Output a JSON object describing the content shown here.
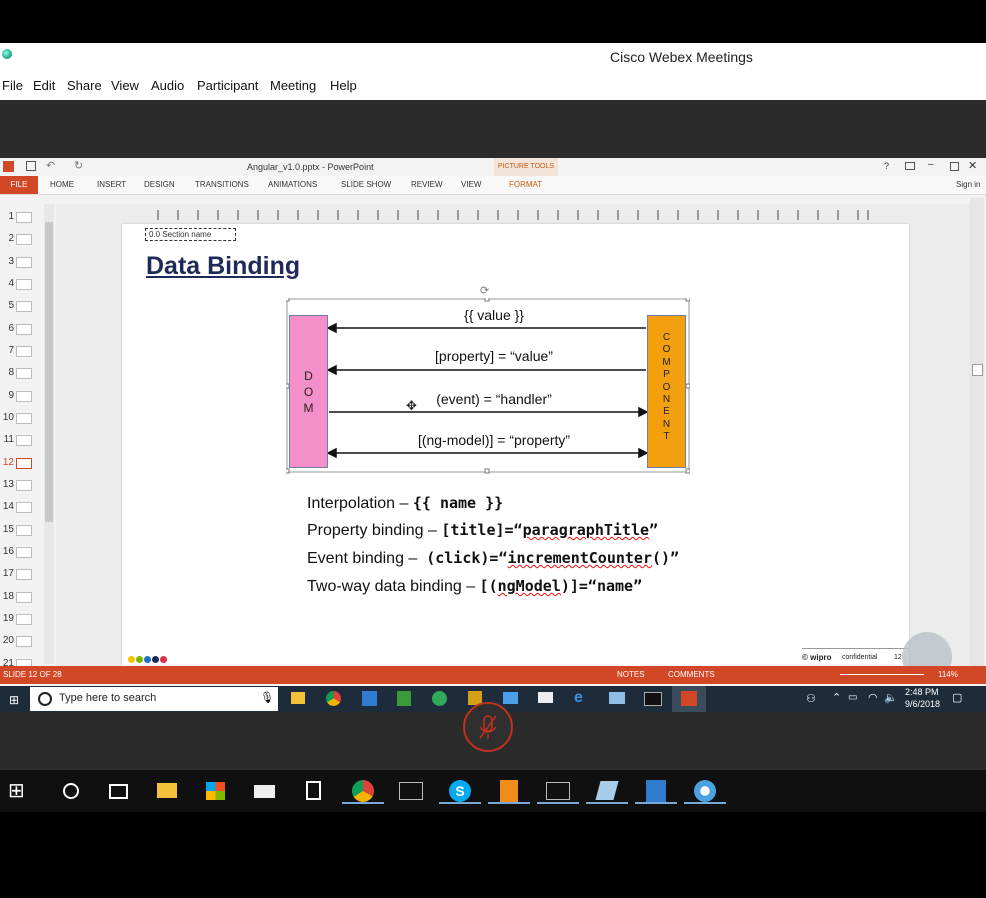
{
  "webex": {
    "title": "Cisco Webex Meetings",
    "menu": [
      "File",
      "Edit",
      "Share",
      "View",
      "Audio",
      "Participant",
      "Meeting",
      "Help"
    ]
  },
  "ppt": {
    "title": "Angular_v1.0.pptx - PowerPoint",
    "picture_tools": "PICTURE TOOLS",
    "file_tab": "FILE",
    "tabs": [
      "HOME",
      "INSERT",
      "DESIGN",
      "TRANSITIONS",
      "ANIMATIONS",
      "SLIDE SHOW",
      "REVIEW",
      "VIEW",
      "FORMAT"
    ],
    "sign_in": "Sign in",
    "help": "?",
    "thumb_numbers": [
      "1",
      "2",
      "3",
      "4",
      "5",
      "6",
      "7",
      "8",
      "9",
      "10",
      "11",
      "12",
      "13",
      "14",
      "15",
      "16",
      "17",
      "18",
      "19",
      "20",
      "21"
    ],
    "selected_slide": "12",
    "status": {
      "slide_of": "SLIDE 12 OF 28",
      "notes": "NOTES",
      "comments": "COMMENTS",
      "zoom": "114%"
    }
  },
  "slide": {
    "section_name": "0.0 Section name",
    "title": "Data Binding",
    "dom_label": "D\nO\nM",
    "component_label": "C\nO\nM\nP\nO\nN\nE\nN\nT",
    "arrows": [
      {
        "label": "{{ value }}"
      },
      {
        "label": "[property] = “value”"
      },
      {
        "label": "(event) = “handler”"
      },
      {
        "label": "[(ng-model)] = “property”"
      }
    ],
    "bindings": [
      {
        "name": "Interpolation – ",
        "code": "{{ name }}"
      },
      {
        "name": "Property binding – ",
        "code_a": "[title]=“",
        "code_b": "paragraphTitle",
        "code_c": "”"
      },
      {
        "name": "Event binding –  ",
        "code_a": "(click)=“",
        "code_b": "incrementCounter",
        "code_c": "()”"
      },
      {
        "name": "Two-way data binding – ",
        "code_a": "[(",
        "code_b": "ngModel",
        "code_c": ")]=“name”"
      }
    ],
    "footer_brand": "© wipro",
    "footer_conf": "confidential",
    "footer_page": "12",
    "dot_colors": [
      "#f5c400",
      "#7ab800",
      "#1e6fc4",
      "#1f2a59",
      "#d9304f"
    ]
  },
  "inner_taskbar": {
    "search_placeholder": "Type here to search",
    "time": "2:48 PM",
    "date": "9/6/2018"
  },
  "colors": {
    "ppt_accent": "#d24726",
    "dom_fill": "#f48fc9",
    "component_fill": "#f4a00e"
  }
}
